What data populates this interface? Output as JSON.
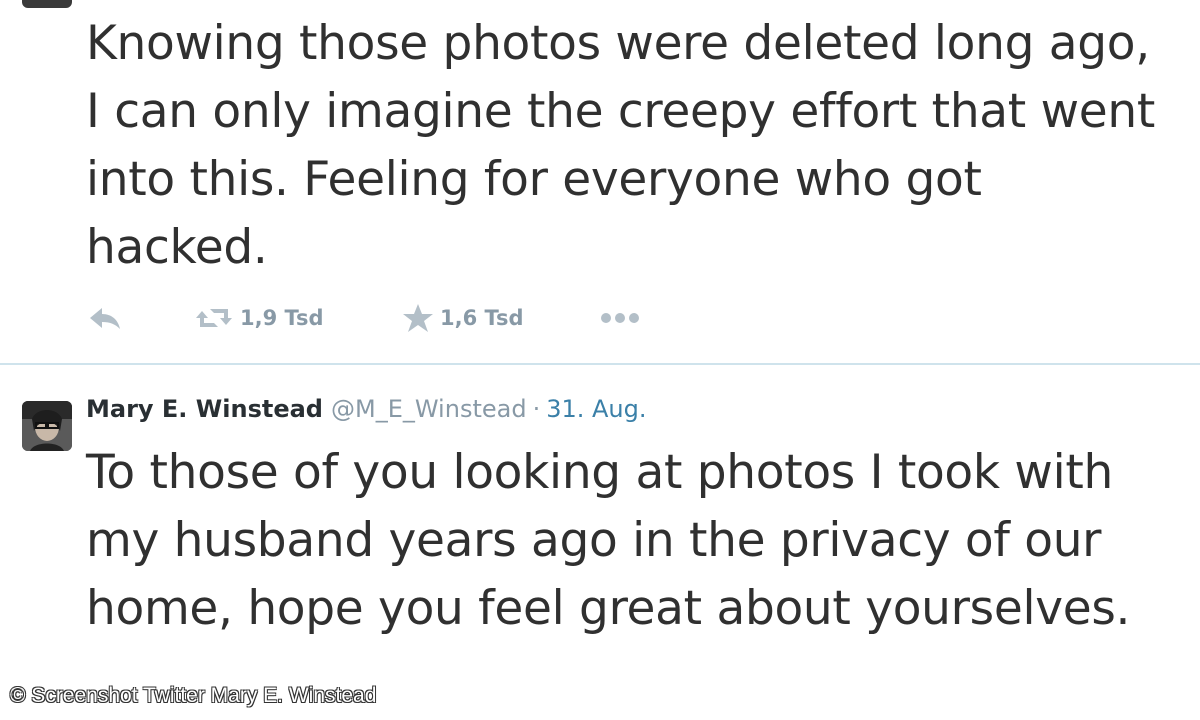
{
  "tweets": [
    {
      "text": "Knowing those photos were deleted long ago, I can only imagine the creepy effort that went into this. Feeling for everyone who got hacked.",
      "actions": {
        "reply_icon": "reply-arrow-icon",
        "retweet_icon": "retweet-icon",
        "retweet_count": "1,9 Tsd",
        "favorite_icon": "star-icon",
        "favorite_count": "1,6 Tsd",
        "more_icon": "more-dots-icon"
      }
    },
    {
      "author": {
        "name": "Mary E. Winstead",
        "handle": "@M_E_Winstead",
        "separator": "·",
        "date": "31. Aug."
      },
      "text": "To those of you looking at photos I took with my husband years ago in the privacy of our home, hope you feel great about yourselves."
    }
  ],
  "caption": "© Screenshot Twitter Mary E. Winstead",
  "colors": {
    "icon_gray": "#b3bfc8",
    "text_gray": "#8899a6",
    "link_blue": "#3b80a8",
    "divider": "#cfe3ec"
  }
}
